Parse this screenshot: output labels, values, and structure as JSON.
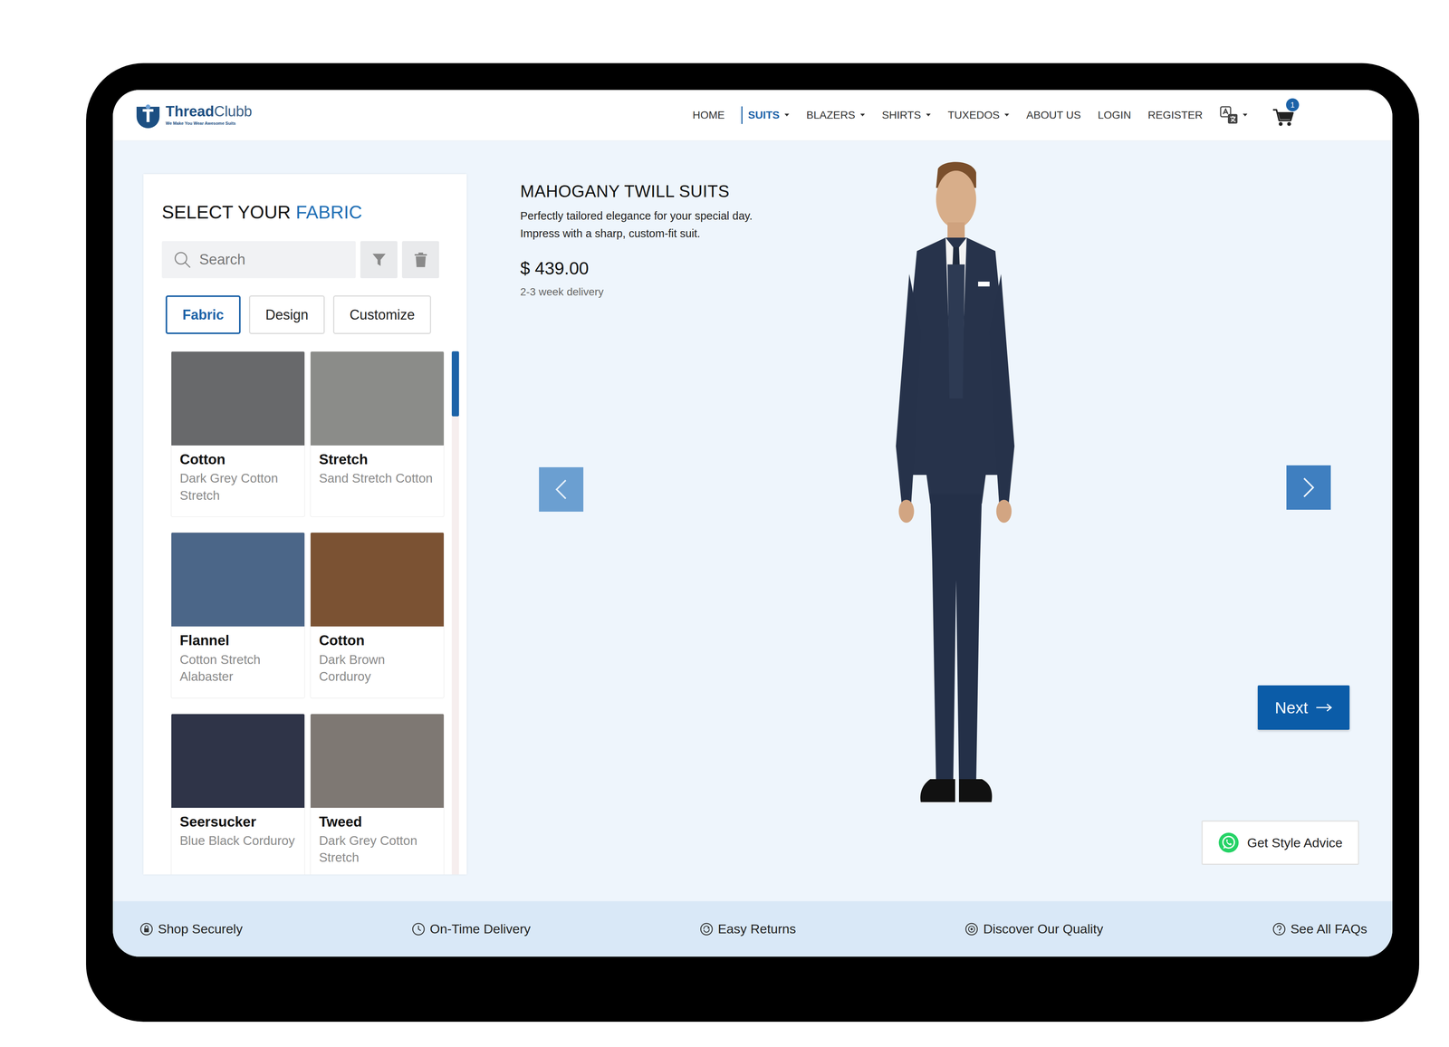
{
  "brand": {
    "name_bold": "Thread",
    "name_light": "Clubb",
    "tagline": "We Make You Wear Awesome Suits"
  },
  "nav": {
    "items": [
      {
        "label": "HOME",
        "selected": false,
        "dropdown": false
      },
      {
        "label": "SUITS",
        "selected": true,
        "dropdown": true
      },
      {
        "label": "BLAZERS",
        "selected": false,
        "dropdown": true
      },
      {
        "label": "SHIRTS",
        "selected": false,
        "dropdown": true
      },
      {
        "label": "TUXEDOS",
        "selected": false,
        "dropdown": true
      },
      {
        "label": "ABOUT US",
        "selected": false,
        "dropdown": false
      },
      {
        "label": "LOGIN",
        "selected": false,
        "dropdown": false
      },
      {
        "label": "REGISTER",
        "selected": false,
        "dropdown": false
      }
    ],
    "cart_count": "1"
  },
  "fabric_panel": {
    "title_prefix": "SELECT YOUR",
    "title_highlight": "FABRIC",
    "search": {
      "placeholder": "Search"
    },
    "tabs": [
      {
        "label": "Fabric",
        "selected": true
      },
      {
        "label": "Design",
        "selected": false
      },
      {
        "label": "Customize",
        "selected": false
      }
    ],
    "fabrics": [
      {
        "name": "Cotton",
        "detail": "Dark Grey Cotton Stretch",
        "color": "#68696b"
      },
      {
        "name": "Stretch",
        "detail": "Sand Stretch Cotton",
        "color": "#8b8c89"
      },
      {
        "name": "Flannel",
        "detail": "Cotton Stretch Alabaster",
        "color": "#4b6688"
      },
      {
        "name": "Cotton",
        "detail": "Dark Brown Corduroy",
        "color": "#7b5233"
      },
      {
        "name": "Seersucker",
        "detail": "Blue Black Corduroy",
        "color": "#2f3448"
      },
      {
        "name": "Tweed",
        "detail": "Dark Grey Cotton Stretch",
        "color": "#7e7873"
      }
    ]
  },
  "product": {
    "title": "MAHOGANY TWILL SUITS",
    "description": [
      "Perfectly tailored elegance for your special day.",
      "Impress with a sharp, custom-fit suit."
    ],
    "price": "$ 439.00",
    "delivery": "2-3 week delivery"
  },
  "buttons": {
    "next": "Next",
    "style_advice": "Get Style Advice"
  },
  "footer": [
    {
      "label": "Shop Securely"
    },
    {
      "label": "On-Time Delivery"
    },
    {
      "label": "Easy Returns"
    },
    {
      "label": "Discover Our Quality"
    },
    {
      "label": "See All FAQs"
    }
  ]
}
